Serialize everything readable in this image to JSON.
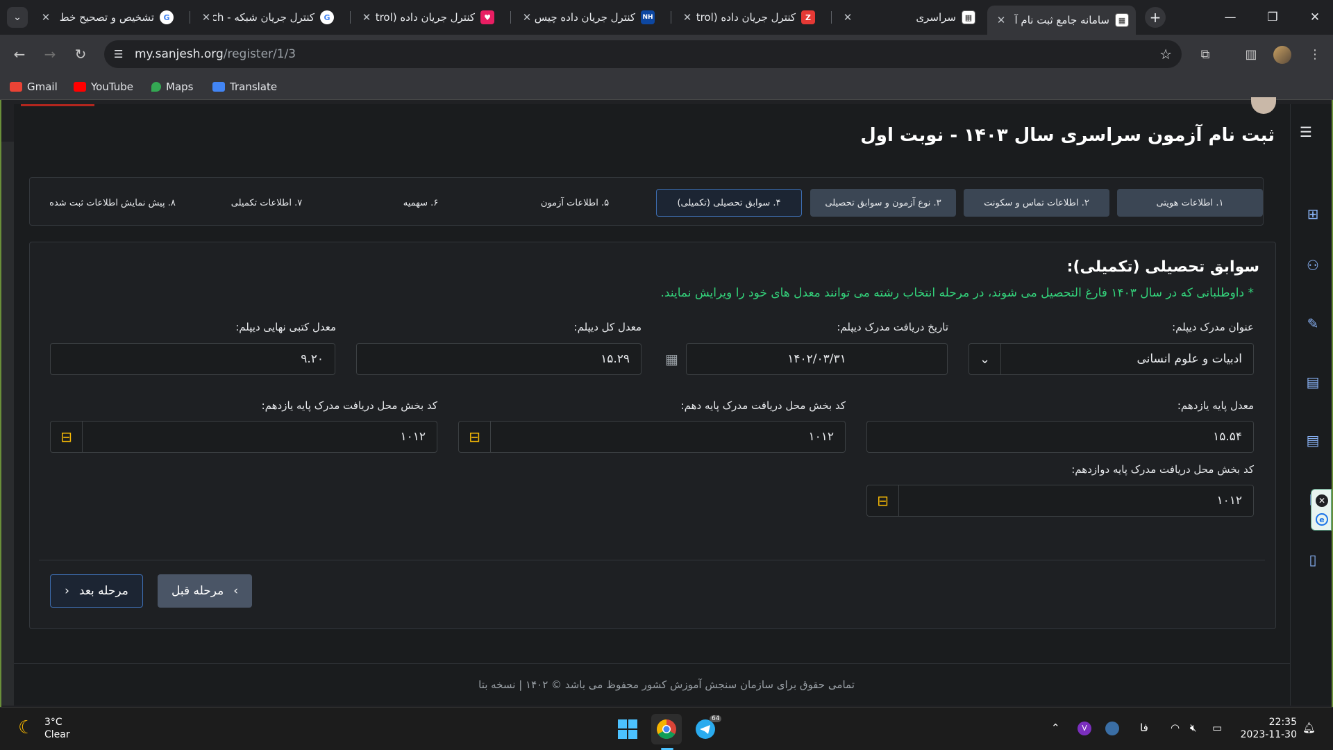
{
  "browser": {
    "tabs": [
      {
        "title": "سامانه جامع ثبت نام آ",
        "active": true,
        "favicon": "sanjesh-icon"
      },
      {
        "title": "سراسری",
        "active": false,
        "favicon": "sanjesh-icon"
      },
      {
        "title": "کنترل جریان داده (trol",
        "active": false,
        "favicon": "z-icon"
      },
      {
        "title": "کنترل جریان داده چیس...",
        "active": false,
        "favicon": "nh-icon"
      },
      {
        "title": "کنترل جریان داده (trol",
        "active": false,
        "favicon": "heart-icon"
      },
      {
        "title": "کنترل جریان شبکه - ch",
        "active": false,
        "favicon": "google-icon"
      },
      {
        "title": "تشخیص و تصحیح خط",
        "active": false,
        "favicon": "google-icon"
      }
    ],
    "url_host": "my.sanjesh.org",
    "url_path": "/register/1/3",
    "bookmarks": [
      {
        "label": "Gmail",
        "color": "#ea4335"
      },
      {
        "label": "YouTube",
        "color": "#ff0000"
      },
      {
        "label": "Maps",
        "color": "#34a853"
      },
      {
        "label": "Translate",
        "color": "#4285f4"
      }
    ]
  },
  "page": {
    "title": "ثبت نام آزمون سراسری سال ۱۴۰۳ - نوبت اول",
    "steps": [
      {
        "label": "۱. اطلاعات هویتی",
        "state": "done"
      },
      {
        "label": "۲. اطلاعات تماس و سکونت",
        "state": "done"
      },
      {
        "label": "۳. نوع آزمون و سوابق تحصیلی",
        "state": "done"
      },
      {
        "label": "۴. سوابق تحصیلی (تکمیلی)",
        "state": "current"
      },
      {
        "label": "۵. اطلاعات آزمون",
        "state": "todo"
      },
      {
        "label": "۶. سهمیه",
        "state": "todo"
      },
      {
        "label": "۷. اطلاعات تکمیلی",
        "state": "todo"
      },
      {
        "label": "۸. پیش نمایش اطلاعات ثبت شده",
        "state": "todo"
      }
    ],
    "section_title": "سوابق تحصیلی (تکمیلی):",
    "note": "* داوطلبانی که در سال ۱۴۰۳ فارغ التحصیل می شوند، در مرحله انتخاب رشته می توانند معدل های خود را ویرایش نمایند.",
    "fields": {
      "diploma_title": {
        "label": "عنوان مدرک دیپلم:",
        "value": "ادبیات و علوم انسانی"
      },
      "diploma_date": {
        "label": "تاریخ دریافت مدرک دیپلم:",
        "value": "۱۴۰۲/۰۳/۳۱"
      },
      "diploma_gpa": {
        "label": "معدل کل دیپلم:",
        "value": "۱۵.۲۹"
      },
      "diploma_written_gpa": {
        "label": "معدل کتبی نهایی دیپلم:",
        "value": "۹.۲۰"
      },
      "grade11_gpa": {
        "label": "معدل پایه یازدهم:",
        "value": "۱۵.۵۴"
      },
      "grade10_code": {
        "label": "کد بخش محل دریافت مدرک پایه دهم:",
        "value": "۱۰۱۲"
      },
      "grade11_code": {
        "label": "کد بخش محل دریافت مدرک پایه یازدهم:",
        "value": "۱۰۱۲"
      },
      "grade12_code": {
        "label": "کد بخش محل دریافت مدرک پایه دوازدهم:",
        "value": "۱۰۱۲"
      }
    },
    "buttons": {
      "next": "مرحله بعد",
      "prev": "مرحله قبل"
    },
    "footer": "تمامی حقوق برای سازمان سنجش آموزش کشور محفوظ می باشد © ۱۴۰۲ | نسخه بتا"
  },
  "taskbar": {
    "temperature": "3°C",
    "condition": "Clear",
    "lang": "فا",
    "time": "22:35",
    "date": "2023-11-30",
    "telegram_badge": "64"
  },
  "colors": {
    "accent": "#3d6db0",
    "success_note": "#33d17a",
    "map_icon": "#fbbc04"
  }
}
